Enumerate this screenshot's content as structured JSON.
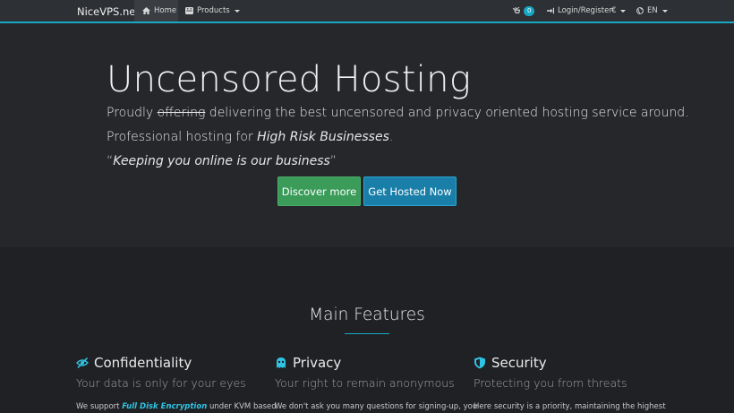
{
  "colors": {
    "accent": "#18a8c4",
    "background": "#1f2124",
    "navbar": "#2d3034",
    "discover_button": "#3b9c5a",
    "hosted_button": "#1a7fa8"
  },
  "nav": {
    "brand": "NiceVPS.net",
    "home": "Home",
    "products": "Products",
    "cart_count": "0",
    "login": "Login/Register",
    "currency": "€",
    "language": "EN",
    "icons": {
      "home": "home-icon",
      "products": "products-icon",
      "cart": "cart-icon",
      "login": "login-icon",
      "language": "globe-icon"
    }
  },
  "hero": {
    "title": "Uncensored Hosting",
    "line1_prefix": "Proudly ",
    "line1_strike": "offering",
    "line1_rest": " delivering the best uncensored and privacy oriented hosting service around.",
    "line2_prefix": "Professional hosting for ",
    "line2_italic": "High Risk Businesses",
    "line2_suffix": ".",
    "line3_open": "“",
    "line3_quote": "Keeping you online is our business",
    "line3_close": "”",
    "discover_button": "Discover more",
    "hosted_button": "Get Hosted Now"
  },
  "features": {
    "title": "Main Features",
    "items": [
      {
        "icon": "eye-slash-icon",
        "title": "Confidentiality",
        "subtitle": "Your data is only for your eyes",
        "desc_prefix": "We support ",
        "desc_highlight": "Full Disk Encryption",
        "desc_suffix": " under KVM based"
      },
      {
        "icon": "ghost-icon",
        "title": "Privacy",
        "subtitle": "Your right to remain anonymous",
        "desc_prefix": "We don't ask you many questions for signing-up, you",
        "desc_highlight": "",
        "desc_suffix": ""
      },
      {
        "icon": "shield-icon",
        "title": "Security",
        "subtitle": "Protecting you from threats",
        "desc_prefix": "Here security is a priority, maintaining the highest",
        "desc_highlight": "",
        "desc_suffix": ""
      }
    ]
  }
}
